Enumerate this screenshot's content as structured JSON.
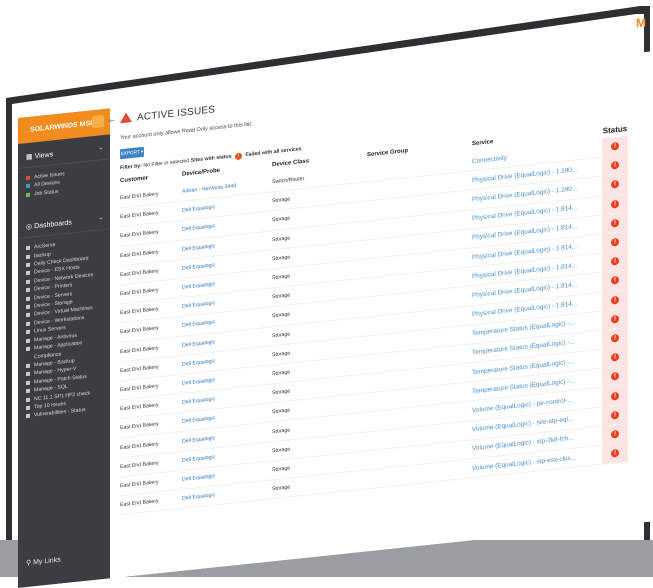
{
  "brand": {
    "name": "SOLARWINDS MSP",
    "corner_letter": "M"
  },
  "sidebar": {
    "views_label": "Views",
    "views_items": [
      {
        "label": "Active Issues",
        "icon": "warning-icon"
      },
      {
        "label": "All Devices",
        "icon": "device-icon"
      },
      {
        "label": "Job Status",
        "icon": "job-icon"
      }
    ],
    "dashboards_label": "Dashboards",
    "dashboard_items": [
      "ArcServe",
      "backup",
      "Daily Check Dashboard",
      "Device - ESX Hosts",
      "Device - Network Devices",
      "Device - Printers",
      "Device - Servers",
      "Device - Storage",
      "Device - Virtual Machines",
      "Device - Workstations",
      "Linux Servers",
      "Manage - Antivirus",
      "Manage - Application Compliance",
      "Manage - Backup",
      "Manage - Hyper-V",
      "Manage - Patch Status",
      "Manage - SQL",
      "NC 11.1 SP1 HF2 check",
      "Top 10 Issues",
      "Vulnerabilities - Status"
    ],
    "my_links_label": "My Links"
  },
  "main": {
    "title": "ACTIVE ISSUES",
    "readonly_notice": "Your account only allows Read Only access to this list.",
    "export_label": "EXPORT ▾",
    "filter": {
      "prefix": "Filter by:",
      "text1": " No Filter in selected ",
      "text2": "Sites with status",
      "badge": "!",
      "text3": " Failed with all services"
    },
    "columns": {
      "customer": "Customer",
      "device": "Device/Probe",
      "class": "Device Class",
      "group": "Service Group",
      "service": "Service",
      "status": "Status"
    },
    "rows": [
      {
        "customer": "East End Bakery",
        "device": "Adtran - NetVanta 3448",
        "class": "Switch/Router",
        "group": "",
        "service": "Connectivity"
      },
      {
        "customer": "East End Bakery",
        "device": "Dell Equalogic",
        "class": "Storage",
        "group": "",
        "service": "Physical Drive (EqualLogic) - 1.190..."
      },
      {
        "customer": "East End Bakery",
        "device": "Dell Equalogic",
        "class": "Storage",
        "group": "",
        "service": "Physical Drive (EqualLogic) - 1.190..."
      },
      {
        "customer": "East End Bakery",
        "device": "Dell Equalogic",
        "class": "Storage",
        "group": "",
        "service": "Physical Drive (EqualLogic) - 1.814..."
      },
      {
        "customer": "East End Bakery",
        "device": "Dell Equalogic",
        "class": "Storage",
        "group": "",
        "service": "Physical Drive (EqualLogic) - 1.814..."
      },
      {
        "customer": "East End Bakery",
        "device": "Dell Equalogic",
        "class": "Storage",
        "group": "",
        "service": "Physical Drive (EqualLogic) - 1.814..."
      },
      {
        "customer": "East End Bakery",
        "device": "Dell Equalogic",
        "class": "Storage",
        "group": "",
        "service": "Physical Drive (EqualLogic) - 1.814..."
      },
      {
        "customer": "East End Bakery",
        "device": "Dell Equalogic",
        "class": "Storage",
        "group": "",
        "service": "Physical Drive (EqualLogic) - 1.814..."
      },
      {
        "customer": "East End Bakery",
        "device": "Dell Equalogic",
        "class": "Storage",
        "group": "",
        "service": "Physical Drive (EqualLogic) - 1.814..."
      },
      {
        "customer": "East End Bakery",
        "device": "Dell Equalogic",
        "class": "Storage",
        "group": "",
        "service": "Temperature Status (EqualLogic) -..."
      },
      {
        "customer": "East End Bakery",
        "device": "Dell Equalogic",
        "class": "Storage",
        "group": "",
        "service": "Temperature Status (EqualLogic) -..."
      },
      {
        "customer": "East End Bakery",
        "device": "Dell Equalogic",
        "class": "Storage",
        "group": "",
        "service": "Temperature Status (EqualLogic) -..."
      },
      {
        "customer": "East End Bakery",
        "device": "Dell Equalogic",
        "class": "Storage",
        "group": "",
        "service": "Temperature Status (EqualLogic) -..."
      },
      {
        "customer": "East End Bakery",
        "device": "Dell Equalogic",
        "class": "Storage",
        "group": "",
        "service": "Volume (EqualLogic) - pe-control-..."
      },
      {
        "customer": "East End Bakery",
        "device": "Dell Equalogic",
        "class": "Storage",
        "group": "",
        "service": "Volume (EqualLogic) - site-stp-eql..."
      },
      {
        "customer": "East End Bakery",
        "device": "Dell Equalogic",
        "class": "Storage",
        "group": "",
        "service": "Volume (EqualLogic) - stp-2k8-fch..."
      },
      {
        "customer": "East End Bakery",
        "device": "Dell Equalogic",
        "class": "Storage",
        "group": "",
        "service": "Volume (EqualLogic) - stp-esx-clus..."
      }
    ],
    "status_badge": "!"
  },
  "colors": {
    "brand_orange": "#f28c1f",
    "sidebar_bg": "#3a3d42",
    "link_blue": "#2f78c4",
    "alert_red": "#e8401f",
    "status_bg": "#fde3e2"
  }
}
